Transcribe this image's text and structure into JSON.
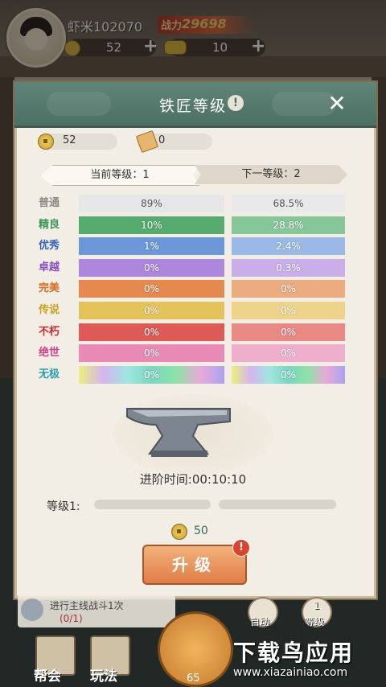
{
  "player": {
    "name": "虾米102070",
    "power_label": "战力",
    "power_value": "29698"
  },
  "resources": {
    "coins": "52",
    "gold": "10"
  },
  "modal": {
    "title": "铁匠等级",
    "coins": "52",
    "scrolls": "0",
    "current_level": "当前等级：1",
    "next_level": "下一等级：2",
    "rarities": [
      {
        "name": "普通",
        "color": "#8a8a8a",
        "cur": "89%",
        "next": "68.5%",
        "cur_bg": "#e6e6e6",
        "next_bg": "#e9e9e9",
        "dark_text": true
      },
      {
        "name": "精良",
        "color": "#3a9a5a",
        "cur": "10%",
        "next": "28.8%",
        "cur_bg": "#56ab6f",
        "next_bg": "#86c79a"
      },
      {
        "name": "优秀",
        "color": "#2f64b8",
        "cur": "1%",
        "next": "2.4%",
        "cur_bg": "#6b96d8",
        "next_bg": "#9ab9e6"
      },
      {
        "name": "卓越",
        "color": "#8a4ec0",
        "cur": "0%",
        "next": "0.3%",
        "cur_bg": "#ad86dd",
        "next_bg": "#c9aeea"
      },
      {
        "name": "完美",
        "color": "#d66a22",
        "cur": "0%",
        "next": "0%",
        "cur_bg": "#e5894f",
        "next_bg": "#edab80"
      },
      {
        "name": "传说",
        "color": "#c9a21c",
        "cur": "0%",
        "next": "0%",
        "cur_bg": "#e6c25a",
        "next_bg": "#eed48a"
      },
      {
        "name": "不朽",
        "color": "#cc2a2a",
        "cur": "0%",
        "next": "0%",
        "cur_bg": "#dd5a57",
        "next_bg": "#e88986"
      },
      {
        "name": "绝世",
        "color": "#d0408a",
        "cur": "0%",
        "next": "0%",
        "cur_bg": "#e989b5",
        "next_bg": "#f0aecd"
      },
      {
        "name": "无极",
        "color": "#2aa0b0",
        "cur": "0%",
        "next": "0%",
        "rainbow": true
      }
    ],
    "advance_time": "进阶时间:00:10:10",
    "level_label": "等级1:",
    "cost": "50",
    "upgrade_button": "升级",
    "badge": "!"
  },
  "bottom": {
    "quest_text": "进行主线战斗1次",
    "quest_progress": "(0/1)",
    "auto_label": "自动",
    "level_label": "等级",
    "level_num": "1",
    "nav_guild": "帮会",
    "nav_play": "玩法",
    "forge_level": "65"
  },
  "watermark": {
    "title": "下载鸟应用",
    "url": "www.xiazainiao.com"
  },
  "icons": [
    "coin-icon",
    "gold-ingot-icon",
    "scroll-icon",
    "info-icon",
    "close-icon",
    "anvil-icon"
  ]
}
